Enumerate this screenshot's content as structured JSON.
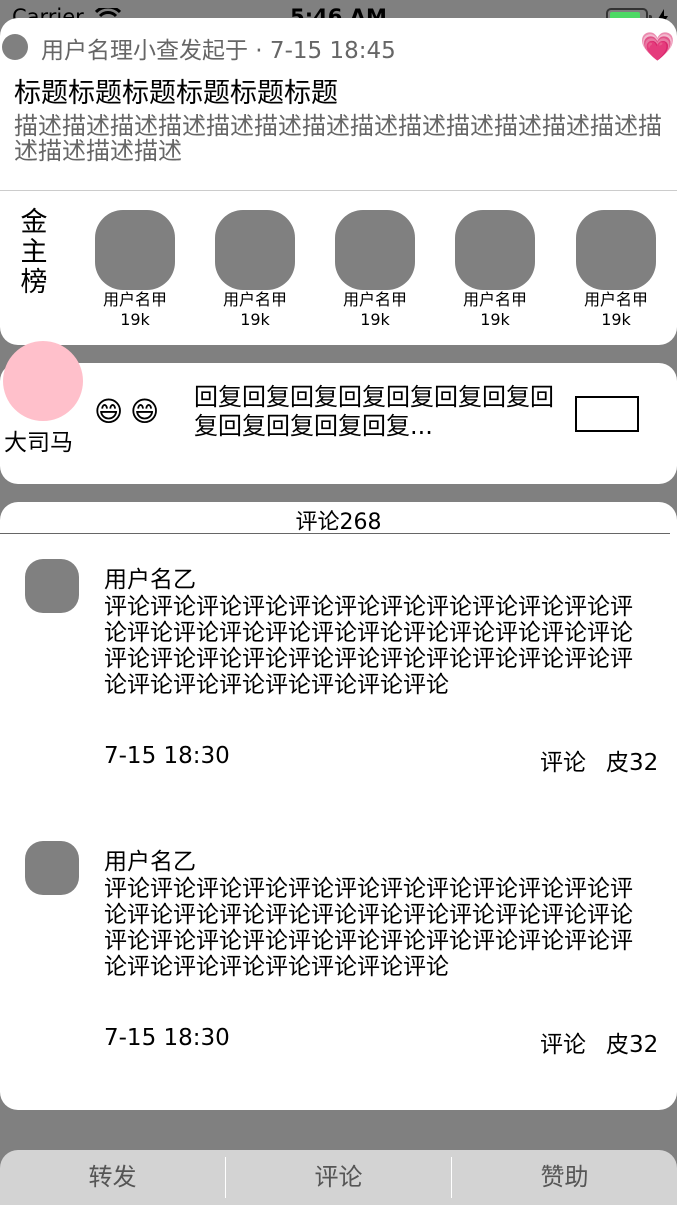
{
  "status_bar": {
    "carrier": "Carrier",
    "time": "5:46 AM"
  },
  "post": {
    "author_line": "用户名理小查发起于 · 7-15 18:45",
    "heart_icon": "sparkling-heart",
    "title": "标题标题标题标题标题标题",
    "description": "描述描述描述描述描述描述描述描述描述描述描述描述描述描述描述描述描述"
  },
  "ranking": {
    "label": "金主榜",
    "items": [
      {
        "name": "用户名甲",
        "count": "19k"
      },
      {
        "name": "用户名甲",
        "count": "19k"
      },
      {
        "name": "用户名甲",
        "count": "19k"
      },
      {
        "name": "用户名甲",
        "count": "19k"
      },
      {
        "name": "用户名甲",
        "count": "19k"
      }
    ]
  },
  "reply_preview": {
    "name": "大司马",
    "emojis": [
      "😄",
      "😄"
    ],
    "text": "回复回复回复回复回复回复回复回复回复回复回复回复..."
  },
  "comments": {
    "title": "评论268",
    "items": [
      {
        "user": "用户名乙",
        "text": "评论评论评论评论评论评论评论评论评论评论评论评论评论评论评论评论评论评论评论评论评论评论评论评论评论评论评论评论评论评论评论评论评论评论评论评论评论评论评论评论评论评论",
        "time": "7-15 18:30",
        "reply_label": "评论",
        "skin_label": "皮32"
      },
      {
        "user": "用户名乙",
        "text": "评论评论评论评论评论评论评论评论评论评论评论评论评论评论评论评论评论评论评论评论评论评论评论评论评论评论评论评论评论评论评论评论评论评论评论评论评论评论评论评论评论评论",
        "time": "7-15 18:30",
        "reply_label": "评论",
        "skin_label": "皮32"
      }
    ]
  },
  "bottom_bar": {
    "forward": "转发",
    "comment": "评论",
    "sponsor": "赞助"
  }
}
